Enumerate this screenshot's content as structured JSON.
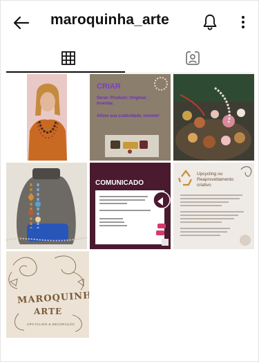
{
  "header": {
    "username": "maroquinha_arte",
    "back_icon": "arrow-left-icon",
    "bell_icon": "bell-icon",
    "more_icon": "more-vertical-icon"
  },
  "tabs": [
    {
      "name": "posts-grid",
      "icon": "grid-icon",
      "active": true
    },
    {
      "name": "tagged",
      "icon": "tagged-person-icon",
      "active": false
    }
  ],
  "posts": [
    {
      "id": "post-1",
      "kind": "photo"
    },
    {
      "id": "post-2",
      "kind": "text",
      "heading": "CRIAR",
      "line1": "Gerar; Produzir; Originar;",
      "line2": "Inventar.",
      "line3": "Aflore sua criatividade, invente!"
    },
    {
      "id": "post-3",
      "kind": "photo"
    },
    {
      "id": "post-4",
      "kind": "photo"
    },
    {
      "id": "post-5",
      "kind": "text",
      "heading": "COMUNICADO"
    },
    {
      "id": "post-6",
      "kind": "text",
      "heading": "Upcycling ou",
      "subheading": "Reaproveitamento",
      "subheading2": "criativo"
    },
    {
      "id": "post-7",
      "kind": "logo",
      "brand_line1": "MAROQUINHA",
      "brand_line2": "ARTE",
      "tagline": "UPCYCLING & DECORAÇÃO"
    }
  ],
  "colors": {
    "accent_purple": "#7b3fc4",
    "comunicado_bg": "#4a1a2e",
    "logo_brown": "#8a6a4a"
  }
}
